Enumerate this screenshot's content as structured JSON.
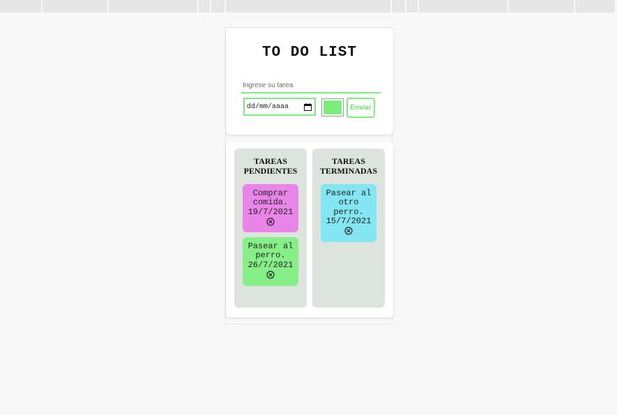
{
  "browser": {
    "toolbar_segments": 13
  },
  "app": {
    "title": "TO DO LIST",
    "form": {
      "task_placeholder": "Ingrese su tarea",
      "date_placeholder": "dd/mm/aaaa",
      "color_value": "#7ced7c",
      "send_label": "Enviar"
    },
    "pending": {
      "title": "TAREAS PENDIENTES",
      "tasks": [
        {
          "text": "Comprar comida.",
          "date": "19/7/2021",
          "color": "#e985e9",
          "delete_icon": "circle-x-icon"
        },
        {
          "text": "Pasear al perro.",
          "date": "26/7/2021",
          "color": "#86ef88",
          "delete_icon": "circle-x-icon"
        }
      ]
    },
    "done": {
      "title": "TAREAS TERMINADAS",
      "tasks": [
        {
          "text": "Pasear al otro perro.",
          "date": "15/7/2021",
          "color": "#84e6f2",
          "delete_icon": "circle-x-icon"
        }
      ]
    }
  },
  "colors": {
    "accent": "#7ced7c",
    "column_bg": "#dde3dd",
    "page_bg": "#f8f8f8"
  }
}
